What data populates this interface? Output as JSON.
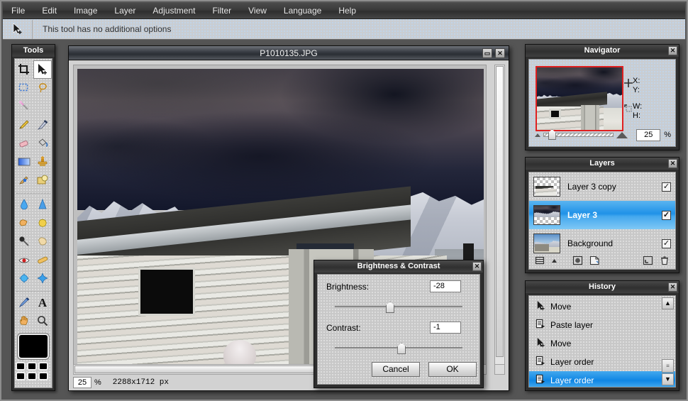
{
  "app": {
    "menu": [
      "File",
      "Edit",
      "Image",
      "Layer",
      "Adjustment",
      "Filter",
      "View",
      "Language",
      "Help"
    ],
    "options_bar": {
      "tool_icon": "move-tool-icon",
      "message": "This tool has no additional options"
    }
  },
  "tools": {
    "title": "Tools",
    "close_label": "✕",
    "items": [
      {
        "name": "crop-tool",
        "glyph": "⌗",
        "active": false
      },
      {
        "name": "move-tool",
        "glyph": "➤",
        "active": true
      },
      {
        "name": "marquee-select-tool",
        "glyph": "⬚",
        "active": false
      },
      {
        "name": "lasso-tool",
        "glyph": "⥁",
        "active": false
      },
      {
        "name": "magic-wand-tool",
        "glyph": "✦",
        "active": false
      },
      {
        "name": "empty-slot-1",
        "glyph": "",
        "active": false
      },
      {
        "name": "pencil-tool",
        "glyph": "✏",
        "active": false
      },
      {
        "name": "brush-tool",
        "glyph": "✒",
        "active": false
      },
      {
        "name": "eraser-tool",
        "glyph": "▰",
        "active": false
      },
      {
        "name": "paint-bucket-tool",
        "glyph": "⛃",
        "active": false
      },
      {
        "name": "gradient-tool",
        "glyph": "▣",
        "active": false
      },
      {
        "name": "clone-stamp-tool",
        "glyph": "⚒",
        "active": false
      },
      {
        "name": "smudge-tool",
        "glyph": "✐",
        "active": false
      },
      {
        "name": "pattern-tool",
        "glyph": "◰",
        "active": false
      },
      {
        "name": "blur-tool",
        "glyph": "●",
        "active": false
      },
      {
        "name": "sharpen-tool",
        "glyph": "▲",
        "active": false
      },
      {
        "name": "dodge-tool",
        "glyph": "☝",
        "active": false
      },
      {
        "name": "sponge-tool",
        "glyph": "◕",
        "active": false
      },
      {
        "name": "burn-tool",
        "glyph": "●",
        "active": false
      },
      {
        "name": "hand-fill-tool",
        "glyph": "✋",
        "active": false
      },
      {
        "name": "red-eye-tool",
        "glyph": "◉",
        "active": false
      },
      {
        "name": "bandage-tool",
        "glyph": "⚕",
        "active": false
      },
      {
        "name": "bloat-tool",
        "glyph": "⬤",
        "active": false
      },
      {
        "name": "pinch-tool",
        "glyph": "✦",
        "active": false
      },
      {
        "name": "pen-tool",
        "glyph": "✒",
        "active": false
      },
      {
        "name": "type-tool",
        "glyph": "A",
        "active": false
      },
      {
        "name": "hand-tool",
        "glyph": "✋",
        "active": false
      },
      {
        "name": "zoom-tool",
        "glyph": "⚲",
        "active": false
      }
    ],
    "foreground_color": "#000000",
    "palette_colors": [
      "#000000",
      "#000000",
      "#000000",
      "#000000",
      "#000000",
      "#000000"
    ]
  },
  "document": {
    "title": "P1010135.JPG",
    "minimize_label": "▭",
    "close_label": "✕",
    "status": {
      "zoom_value": "25",
      "zoom_unit": "%",
      "dimensions": "2288x1712 px"
    }
  },
  "navigator": {
    "title": "Navigator",
    "close_label": "✕",
    "position_labels": [
      "X:",
      "Y:"
    ],
    "size_labels": [
      "W:",
      "H:"
    ],
    "position_values": [
      "",
      ""
    ],
    "size_values": [
      "",
      ""
    ],
    "zoom_out_icon": "small-triangle-icon",
    "zoom_in_icon": "large-triangle-icon",
    "zoom_value": "25",
    "zoom_unit": "%",
    "crosshair_icon": "crosshair-icon",
    "rect_icon": "selection-rect-icon"
  },
  "layers": {
    "title": "Layers",
    "close_label": "✕",
    "items": [
      {
        "name": "Layer 3 copy",
        "visible": true,
        "selected": false,
        "thumb": "transparent-cabin"
      },
      {
        "name": "Layer 3",
        "visible": true,
        "selected": true,
        "thumb": "transparent-sky"
      },
      {
        "name": "Background",
        "visible": true,
        "selected": false,
        "thumb": "full-photo"
      }
    ],
    "check_glyph": "✓",
    "toolbar": [
      {
        "name": "layer-properties-button",
        "glyph": "☰"
      },
      {
        "name": "layer-properties-arrow",
        "glyph": "▲"
      },
      {
        "name": "layer-mask-button",
        "glyph": "▣"
      },
      {
        "name": "new-layer-button",
        "glyph": "❐"
      },
      {
        "name": "merge-layer-button",
        "glyph": "◥"
      },
      {
        "name": "delete-layer-button",
        "glyph": "🗑"
      }
    ]
  },
  "history": {
    "title": "History",
    "close_label": "✕",
    "items": [
      {
        "label": "Move",
        "icon": "➤",
        "selected": false
      },
      {
        "label": "Paste layer",
        "icon": "☷",
        "selected": false
      },
      {
        "label": "Move",
        "icon": "➤",
        "selected": false
      },
      {
        "label": "Layer order",
        "icon": "☷",
        "selected": false
      },
      {
        "label": "Layer order",
        "icon": "☷",
        "selected": true
      }
    ],
    "scroll_up_glyph": "▲",
    "scroll_down_glyph": "▼",
    "scroll_thumb_glyph": "≡"
  },
  "brightness_contrast": {
    "title": "Brightness & Contrast",
    "close_label": "✕",
    "brightness_label": "Brightness:",
    "brightness_value": "-28",
    "brightness_slider_pct": 40,
    "contrast_label": "Contrast:",
    "contrast_value": "-1",
    "contrast_slider_pct": 49,
    "cancel_label": "Cancel",
    "ok_label": "OK"
  },
  "colors": {
    "selection_blue": "#1f92e8",
    "panel_gray": "#c8c8c8",
    "title_dark": "#303030",
    "nav_rect_red": "#e02020"
  }
}
